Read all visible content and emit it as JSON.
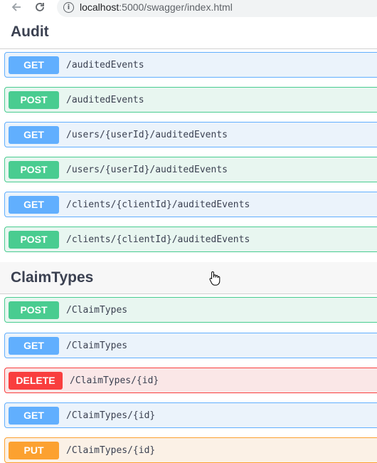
{
  "browser": {
    "url_host": "localhost",
    "url_rest": ":5000/swagger/index.html"
  },
  "tags": [
    {
      "title": "Audit",
      "operations": [
        {
          "method": "GET",
          "path": "/auditedEvents"
        },
        {
          "method": "POST",
          "path": "/auditedEvents"
        },
        {
          "method": "GET",
          "path": "/users/{userId}/auditedEvents"
        },
        {
          "method": "POST",
          "path": "/users/{userId}/auditedEvents"
        },
        {
          "method": "GET",
          "path": "/clients/{clientId}/auditedEvents"
        },
        {
          "method": "POST",
          "path": "/clients/{clientId}/auditedEvents"
        }
      ]
    },
    {
      "title": "ClaimTypes",
      "operations": [
        {
          "method": "POST",
          "path": "/ClaimTypes"
        },
        {
          "method": "GET",
          "path": "/ClaimTypes"
        },
        {
          "method": "DELETE",
          "path": "/ClaimTypes/{id}"
        },
        {
          "method": "GET",
          "path": "/ClaimTypes/{id}"
        },
        {
          "method": "PUT",
          "path": "/ClaimTypes/{id}"
        }
      ]
    }
  ],
  "colors": {
    "get": "#61affe",
    "post": "#49cc90",
    "delete": "#f93e3e",
    "put": "#fca130"
  }
}
